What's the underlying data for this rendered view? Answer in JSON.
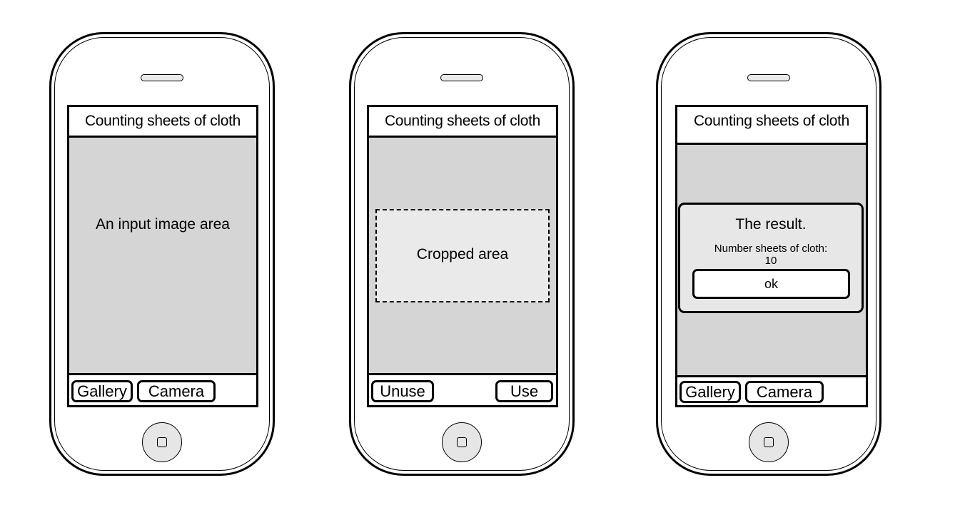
{
  "app_title": "Counting sheets of cloth",
  "screen1": {
    "image_area_label": "An input image area",
    "gallery_button": "Gallery",
    "camera_button": "Camera"
  },
  "screen2": {
    "cropped_area_label": "Cropped area",
    "unuse_button": "Unuse",
    "use_button": "Use"
  },
  "screen3": {
    "dialog_title": "The result.",
    "result_label": "Number sheets of  cloth:",
    "result_value": "10",
    "ok_button": "ok",
    "gallery_button": "Gallery",
    "camera_button": "Camera"
  },
  "colors": {
    "screen_background": "#d5d5d5",
    "crop_background": "#eaeaea",
    "dialog_background": "#e7e7e7",
    "outline": "#000000"
  },
  "icons": {
    "speaker": "speaker-slot-icon",
    "home": "home-button-icon"
  }
}
